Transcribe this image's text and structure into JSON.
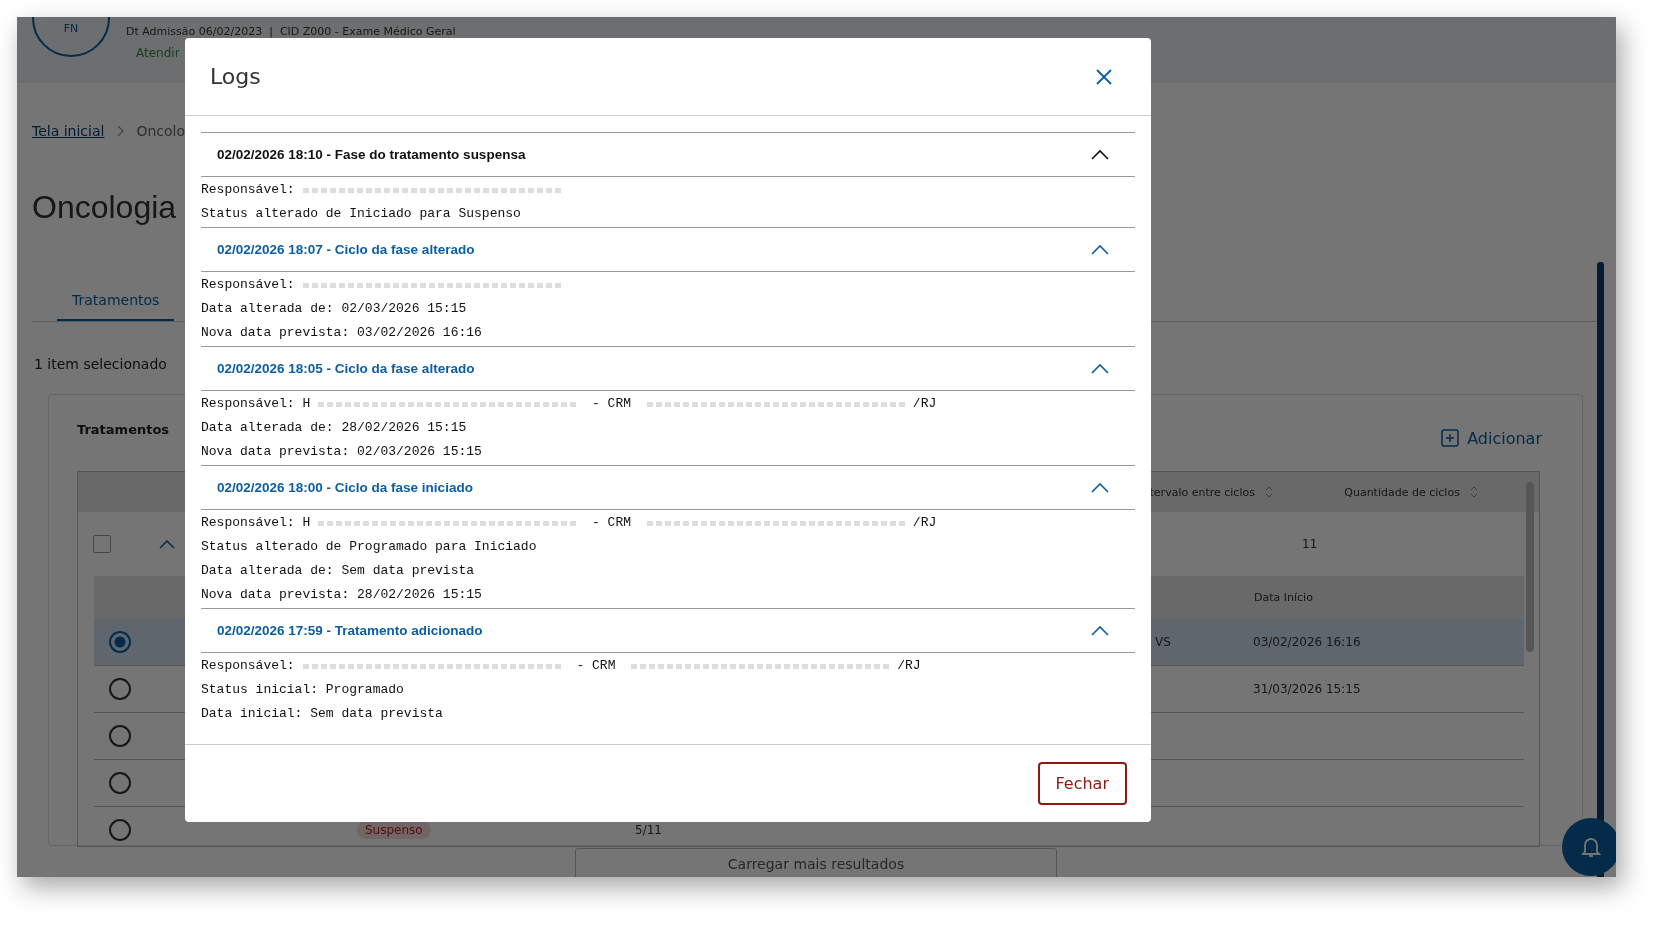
{
  "background": {
    "patient": {
      "avatar": "FN",
      "info": "Dt Admissão 06/02/2023  |  CID Z000 - Exame Médico Geral",
      "status": "Atendir"
    },
    "breadcrumb": [
      "Tela inicial",
      "Oncolo"
    ],
    "title": "Oncologia",
    "tabs": [
      {
        "label": "Tratamentos",
        "selected": true
      }
    ],
    "selection": "1 item selecionado",
    "card": {
      "title": "Tratamentos",
      "add": "Adicionar",
      "table": {
        "columns": [
          "tervalo entre ciclos",
          "Quantidade de ciclos"
        ],
        "row": {
          "checked": false,
          "expanded": true,
          "cycles": "11"
        },
        "sub_columns": [
          "Data Início"
        ],
        "sub_rows": [
          {
            "selected": true,
            "column_5": "VS",
            "start": "03/02/2026 16:16",
            "status": "",
            "cycles": ""
          },
          {
            "selected": false,
            "column_5": "",
            "start": "31/03/2026 15:15",
            "status": "",
            "cycles": ""
          },
          {
            "selected": false,
            "column_5": "",
            "start": "",
            "status": "",
            "cycles": ""
          },
          {
            "selected": false,
            "column_5": "",
            "start": "",
            "status": "",
            "cycles": ""
          },
          {
            "selected": false,
            "column_5": "",
            "start": "",
            "status": "Suspenso",
            "cycles": "5/11"
          }
        ]
      }
    },
    "load_more": "Carregar mais resultados"
  },
  "modal": {
    "title": "Logs",
    "footer_button": "Fechar",
    "entries": [
      {
        "header": "02/02/2026 18:10 - Fase do tratamento suspensa",
        "focused": true,
        "expanded": true,
        "lines": [
          [
            {
              "kind": "text",
              "text": "Responsável:"
            },
            {
              "kind": "blur"
            }
          ],
          [
            {
              "kind": "text",
              "text": "Status alterado de Iniciado para Suspenso"
            }
          ]
        ]
      },
      {
        "header": "02/02/2026 18:07 - Ciclo da fase alterado",
        "focused": false,
        "expanded": true,
        "lines": [
          [
            {
              "kind": "text",
              "text": "Responsável:"
            },
            {
              "kind": "blur"
            }
          ],
          [
            {
              "kind": "text",
              "text": "Data alterada de: 02/03/2026 15:15"
            }
          ],
          [
            {
              "kind": "text",
              "text": "Nova data prevista: 03/02/2026 16:16"
            }
          ]
        ]
      },
      {
        "header": "02/02/2026 18:05 - Ciclo da fase alterado",
        "focused": false,
        "expanded": true,
        "lines": [
          [
            {
              "kind": "text",
              "text": "Responsável: H"
            },
            {
              "kind": "blur"
            },
            {
              "kind": "text",
              "text": " - CRM "
            },
            {
              "kind": "blur"
            },
            {
              "kind": "text",
              "text": "/RJ"
            }
          ],
          [
            {
              "kind": "text",
              "text": "Data alterada de: 28/02/2026 15:15"
            }
          ],
          [
            {
              "kind": "text",
              "text": "Nova data prevista: 02/03/2026 15:15"
            }
          ]
        ]
      },
      {
        "header": "02/02/2026 18:00 - Ciclo da fase iniciado",
        "focused": false,
        "expanded": true,
        "lines": [
          [
            {
              "kind": "text",
              "text": "Responsável: H"
            },
            {
              "kind": "blur"
            },
            {
              "kind": "text",
              "text": " - CRM "
            },
            {
              "kind": "blur"
            },
            {
              "kind": "text",
              "text": "/RJ"
            }
          ],
          [
            {
              "kind": "text",
              "text": "Status alterado de Programado para Iniciado"
            }
          ],
          [
            {
              "kind": "text",
              "text": "Data alterada de: Sem data prevista"
            }
          ],
          [
            {
              "kind": "text",
              "text": "Nova data prevista: 28/02/2026 15:15"
            }
          ]
        ]
      },
      {
        "header": "02/02/2026 17:59 - Tratamento adicionado",
        "focused": false,
        "expanded": true,
        "lines": [
          [
            {
              "kind": "text",
              "text": "Responsável:"
            },
            {
              "kind": "blur"
            },
            {
              "kind": "text",
              "text": " - CRM "
            },
            {
              "kind": "blur"
            },
            {
              "kind": "text",
              "text": "/RJ"
            }
          ],
          [
            {
              "kind": "text",
              "text": "Status inicial: Programado"
            }
          ],
          [
            {
              "kind": "text",
              "text": "Data inicial: Sem data prevista"
            }
          ]
        ]
      }
    ]
  }
}
